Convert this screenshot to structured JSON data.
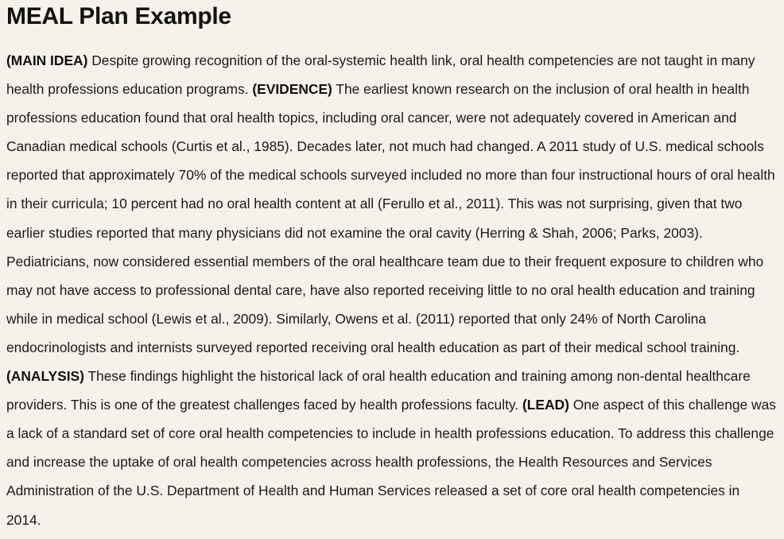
{
  "title": "MEAL Plan Example",
  "paragraph": {
    "main_idea_tag": "(MAIN IDEA)",
    "main_idea_text": " Despite growing recognition of the oral-systemic health link, oral health competencies are not taught in many health professions education programs. ",
    "evidence_tag": "(EVIDENCE)",
    "evidence_text": " The earliest known research on the inclusion of oral health in health professions education found that oral health topics, including oral cancer, were not adequately covered in American and Canadian medical schools (Curtis et al., 1985). Decades later, not much had changed. A 2011 study of U.S. medical schools reported that approximately 70% of the medical schools surveyed included no more than four instructional hours of oral health in their curricula; 10 percent had no oral health content at all (Ferullo et al., 2011). This was not surprising, given that two earlier studies reported that many physicians did not examine the oral cavity (Herring & Shah, 2006; Parks, 2003). Pediatricians, now considered essential members of the oral healthcare team due to their frequent exposure to children who may not have access to professional dental care, have also reported receiving little to no oral health education and training while in medical school (Lewis et al., 2009). Similarly, Owens et al. (2011) reported that only 24% of North Carolina endocrinologists and internists surveyed reported receiving oral health education as part of their medical school training. ",
    "analysis_tag": "(ANALYSIS)",
    "analysis_text": " These findings highlight the historical lack of oral health education and training among non-dental healthcare providers. This is one of the greatest challenges faced by health professions faculty. ",
    "lead_tag": "(LEAD)",
    "lead_text": " One aspect of this challenge was a lack of a standard set of core oral health competencies to include in health professions education. To address this challenge and increase the uptake of oral health competencies across health professions, the Health Resources and Services Administration of the U.S. Department of Health and Human Services released a set of core oral health competencies in 2014."
  }
}
